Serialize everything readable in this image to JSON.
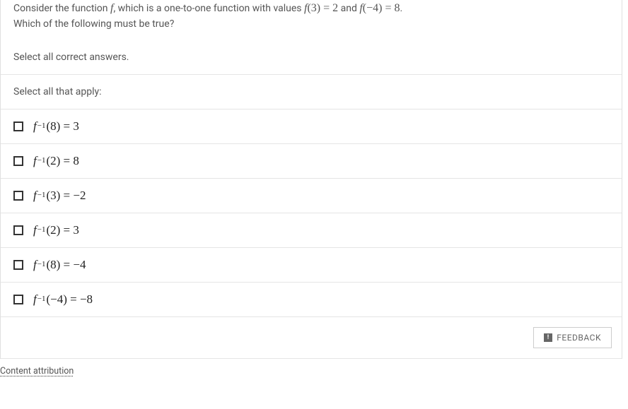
{
  "question": {
    "intro": "Consider the function ",
    "func_letter": "f",
    "mid1": ", which is a one-to-one function with values ",
    "eq1_lhs": "f",
    "eq1_args": "(3) = 2",
    "mid2": " and ",
    "eq2_lhs": "f",
    "eq2_args": "(−4) = 8",
    "period": ".",
    "line2": "Which of the following must be true?",
    "instruction": "Select all correct answers.",
    "select_label": "Select all that apply:"
  },
  "options": [
    {
      "f": "f",
      "sup": "−1",
      "rest": "(8) = 3"
    },
    {
      "f": "f",
      "sup": "−1",
      "rest": "(2) = 8"
    },
    {
      "f": "f",
      "sup": "−1",
      "rest": "(3) = −2"
    },
    {
      "f": "f",
      "sup": "−1",
      "rest": "(2) = 3"
    },
    {
      "f": "f",
      "sup": "−1",
      "rest": "(8) = −4"
    },
    {
      "f": "f",
      "sup": "−1",
      "rest": "(−4) = −8"
    }
  ],
  "feedback_label": "FEEDBACK",
  "attribution": "Content attribution"
}
